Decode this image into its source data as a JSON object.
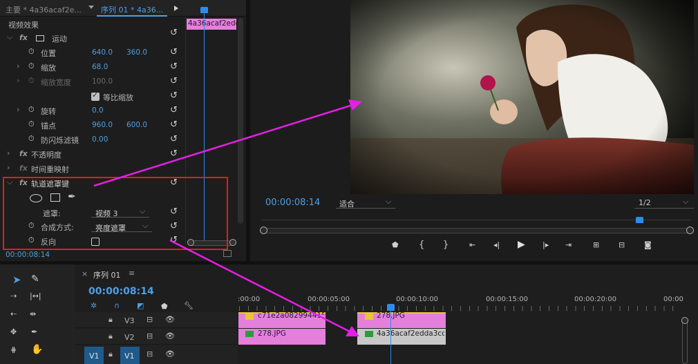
{
  "effect_controls": {
    "tab_master": "主要 * 4a36acaf2e...",
    "tab_sequence": "序列 01 * 4a36...",
    "clip_label": "4a36acaf2edd",
    "section_video_effects": "视频效果",
    "motion": "运动",
    "position_label": "位置",
    "position_x": "640.0",
    "position_y": "360.0",
    "scale_label": "缩放",
    "scale_value": "68.0",
    "scale_width_label": "缩放宽度",
    "scale_width_value": "100.0",
    "uniform_scale_label": "等比缩放",
    "rotation_label": "旋转",
    "rotation_value": "0.0",
    "anchor_label": "锚点",
    "anchor_x": "960.0",
    "anchor_y": "600.0",
    "antiflicker_label": "防闪烁滤镜",
    "antiflicker_value": "0.00",
    "opacity": "不透明度",
    "time_remap": "时间重映射",
    "track_matte": "轨道遮罩键",
    "matte_label": "遮罩:",
    "matte_value": "视频 3",
    "composite_label": "合成方式:",
    "composite_value": "亮度遮罩",
    "reverse_label": "反向",
    "timecode": "00:00:08:14",
    "fx_glyph": "fx"
  },
  "program_monitor": {
    "timecode": "00:00:08:14",
    "fit_value": "适合",
    "resolution_value": "1/2",
    "colors": {
      "timecode": "#4f9fe6",
      "playhead": "#2d8ceb"
    }
  },
  "timeline": {
    "sequence_name": "序列 01",
    "timecode": "00:00:08:14",
    "ruler_labels": [
      ":00:00",
      "00:00:05:00",
      "00:00:10:00",
      "00:00:15:00",
      "00:00:20:00",
      "00:00"
    ],
    "tracks": [
      {
        "name": "V3"
      },
      {
        "name": "V2"
      },
      {
        "name": "V1",
        "source": "V1"
      }
    ],
    "clips": {
      "v3_a": "c71e2a0829944150...",
      "v3_b": "278.JPG",
      "v2_a": "278.JPG",
      "v2_b": "4a36acaf2edda3cc7..."
    },
    "colors": {
      "clip": "#e47fdc",
      "selected_clip": "#c8c8c8",
      "fx_badge": "#e8c43a",
      "highlight_box": "#e01e1e",
      "arrow": "#e61fe6"
    }
  }
}
